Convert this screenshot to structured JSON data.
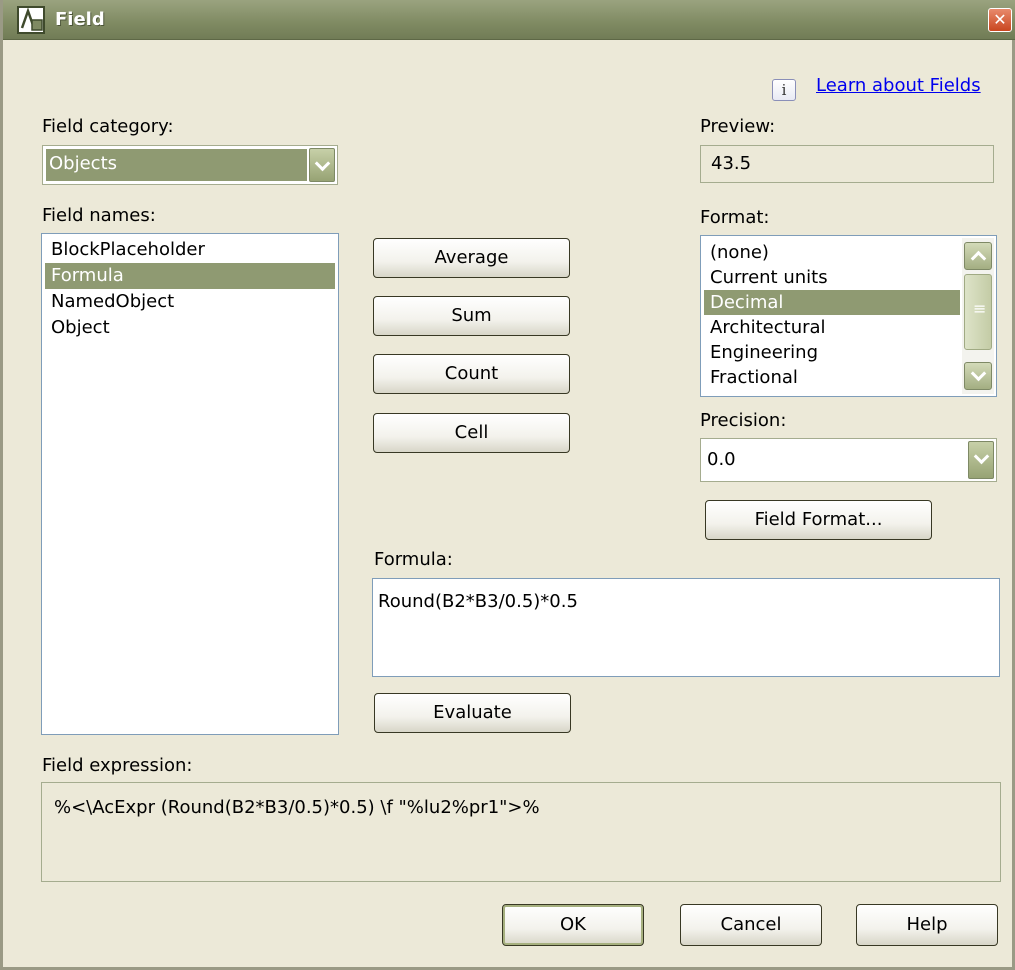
{
  "window": {
    "title": "Field",
    "close_symbol": "✕"
  },
  "help": {
    "info_symbol": "i",
    "learn_link": "Learn about Fields"
  },
  "category": {
    "label": "Field category:",
    "value": "Objects"
  },
  "preview": {
    "label": "Preview:",
    "value": "43.5"
  },
  "field_names": {
    "label": "Field names:",
    "items": [
      "BlockPlaceholder",
      "Formula",
      "NamedObject",
      "Object"
    ],
    "selected": "Formula"
  },
  "formula_buttons": {
    "average": "Average",
    "sum": "Sum",
    "count": "Count",
    "cell": "Cell"
  },
  "format": {
    "label": "Format:",
    "items": [
      "(none)",
      "Current units",
      "Decimal",
      "Architectural",
      "Engineering",
      "Fractional"
    ],
    "selected": "Decimal"
  },
  "precision": {
    "label": "Precision:",
    "value": "0.0"
  },
  "field_format_button": "Field Format...",
  "formula": {
    "label": "Formula:",
    "value": "Round(B2*B3/0.5)*0.5"
  },
  "evaluate_button": "Evaluate",
  "expression": {
    "label": "Field expression:",
    "value": "%<\\AcExpr (Round(B2*B3/0.5)*0.5) \\f \"%lu2%pr1\">%"
  },
  "footer": {
    "ok": "OK",
    "cancel": "Cancel",
    "help": "Help"
  },
  "colors": {
    "selection": "#8F9A72",
    "dialog_bg": "#ECE9D8",
    "titlebar": "#7F8A62",
    "link": "#0000EE"
  }
}
